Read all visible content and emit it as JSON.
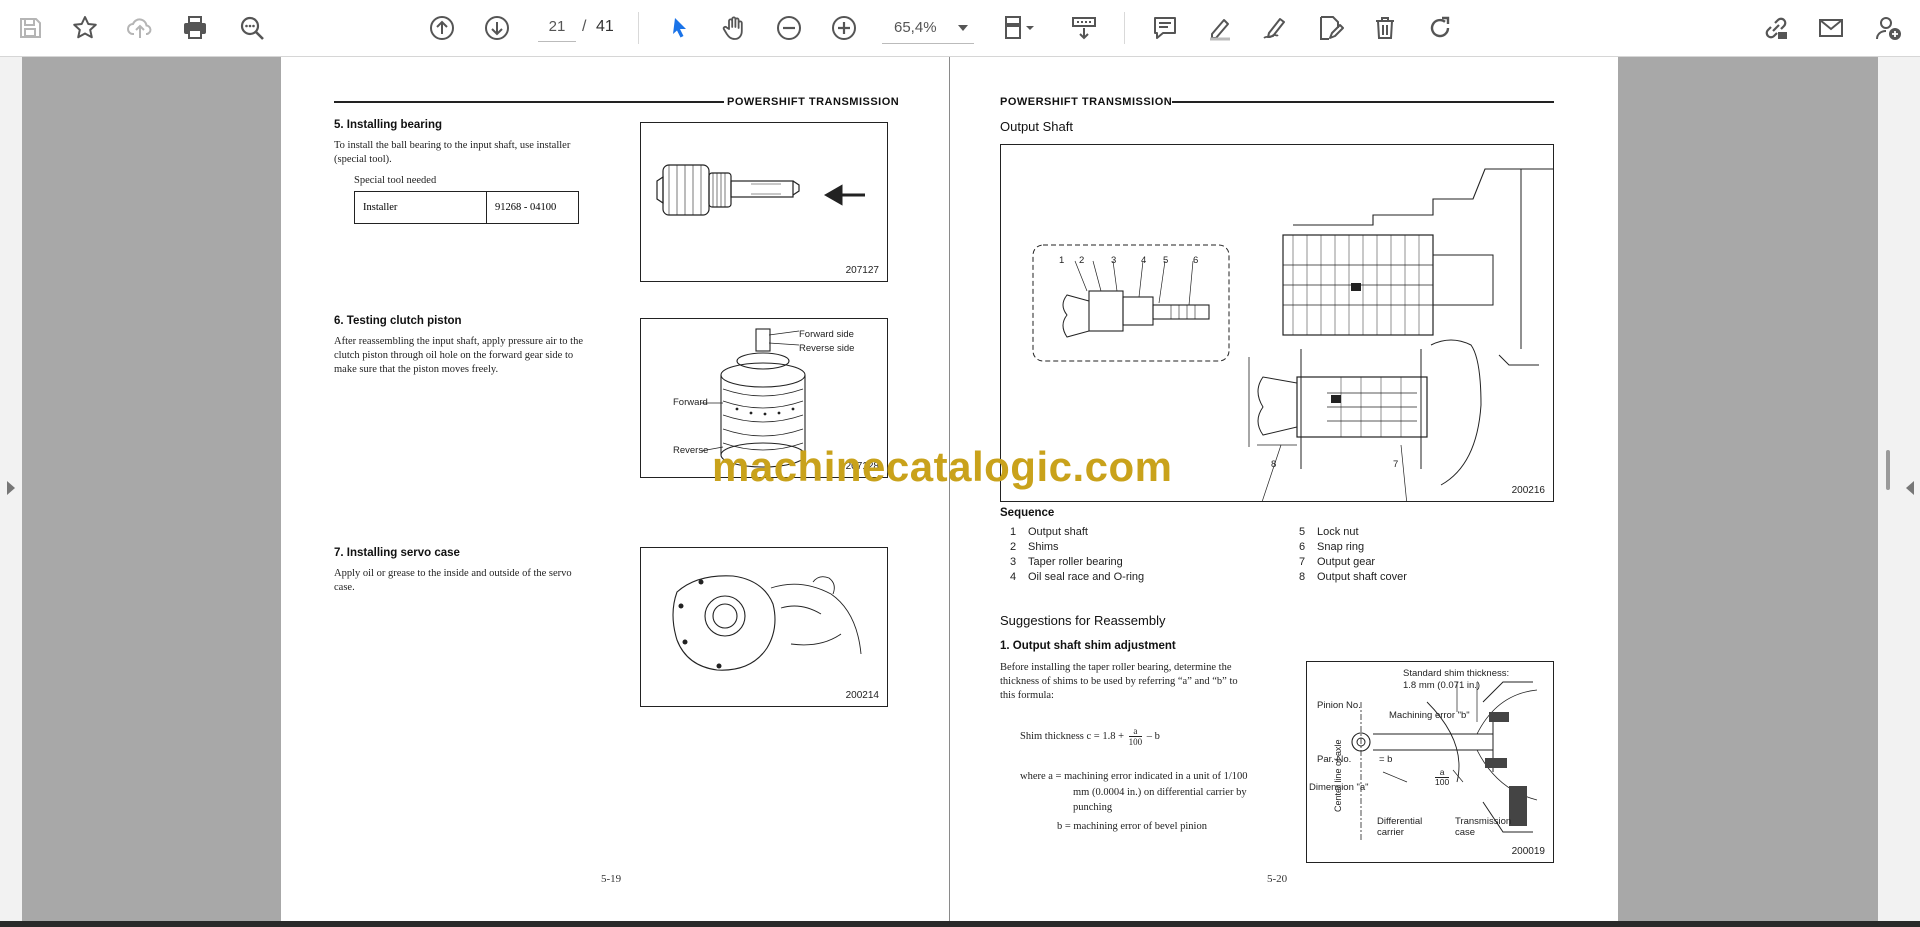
{
  "toolbar": {
    "page_current": "21",
    "page_separator": "/",
    "page_total": "41",
    "zoom": "65,4%"
  },
  "left_page": {
    "header": "POWERSHIFT  TRANSMISSION",
    "s5_title": "5.    Installing bearing",
    "s5_body": [
      "To install the ball bearing to the input shaft, use installer",
      "(special tool)."
    ],
    "special_tool_label": "Special tool needed",
    "tool_name": "Installer",
    "tool_number": "91268 - 04100",
    "fig1_num": "207127",
    "s6_title": "6.    Testing clutch piston",
    "s6_body": [
      "After reassembling the input shaft, apply pressure air to the",
      "clutch piston through oil hole on the forward gear side to",
      "make sure that the piston moves freely."
    ],
    "fig2_num": "207128",
    "fig2_labels": {
      "forward_side": "Forward side",
      "reverse_side": "Reverse side",
      "forward": "Forward",
      "reverse": "Reverse"
    },
    "s7_title": "7.    Installing servo case",
    "s7_body": [
      "Apply oil or grease to the inside and outside of the servo",
      "case."
    ],
    "fig3_num": "200214",
    "page_number": "5-19"
  },
  "right_page": {
    "header": "POWERSHIFT  TRANSMISSION",
    "title": "Output Shaft",
    "fig_num": "200216",
    "callouts": [
      "1",
      "2",
      "3",
      "4",
      "5",
      "6",
      "7",
      "8"
    ],
    "sequence_title": "Sequence",
    "sequence": [
      {
        "n": "1",
        "label": "Output shaft"
      },
      {
        "n": "2",
        "label": "Shims"
      },
      {
        "n": "3",
        "label": "Taper roller bearing"
      },
      {
        "n": "4",
        "label": "Oil seal race and O-ring"
      },
      {
        "n": "5",
        "label": "Lock nut"
      },
      {
        "n": "6",
        "label": "Snap ring"
      },
      {
        "n": "7",
        "label": "Output gear"
      },
      {
        "n": "8",
        "label": "Output shaft cover"
      }
    ],
    "suggestions_title": "Suggestions for Reassembly",
    "s1_title": "1.    Output shaft shim adjustment",
    "s1_body": [
      "Before installing the taper roller bearing, determine the",
      "thickness of shims to be used by referring “a” and “b” to",
      "this formula:"
    ],
    "formula_lhs": "Shim thickness c = 1.8 +",
    "formula_num": "a",
    "formula_den": "100",
    "formula_rhs": "– b",
    "where_a_1": "where   a = machining error indicated in a unit of 1/100",
    "where_a_2": "mm (0.0004 in.) on differential carrier by",
    "where_a_3": "punching",
    "where_b": "b =  machining error of bevel pinion",
    "fig2_num": "200019",
    "fig2_labels": {
      "std_shim": "Standard shim thickness:",
      "std_shim_val": "1.8 mm (0.071 in.)",
      "pinion_no": "Pinion No.",
      "machining_error": "Machining error \"b\"",
      "part_no": "Par. No.",
      "eq_b": "= b",
      "dimension_a": "Dimension \"a\"",
      "a_frac_num": "a",
      "a_frac_den": "100",
      "center_line": "Center line of axle",
      "diff_carrier": "Differential carrier",
      "trans_case": "Transmission case"
    },
    "page_number": "5-20"
  },
  "watermark": "machinecatalogic.com"
}
